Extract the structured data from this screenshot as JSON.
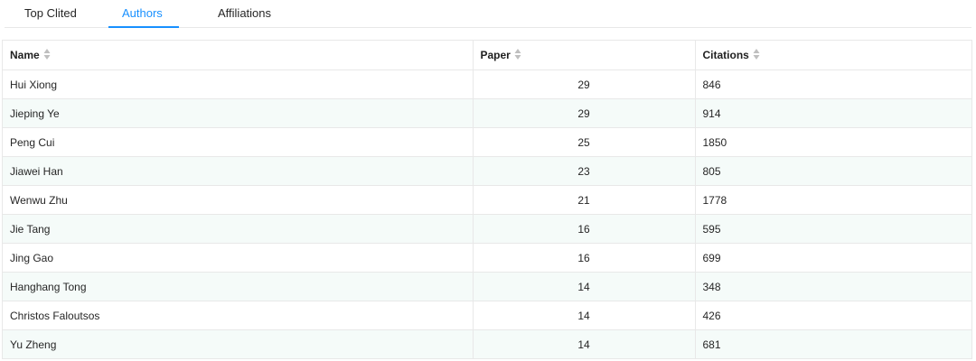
{
  "tabs": [
    {
      "label": "Top Clited",
      "active": false
    },
    {
      "label": "Authors",
      "active": true
    },
    {
      "label": "Affiliations",
      "active": false
    }
  ],
  "table": {
    "columns": [
      {
        "label": "Name",
        "sort_icon": "sort-icon"
      },
      {
        "label": "Paper",
        "sort_icon": "sort-icon"
      },
      {
        "label": "Citations",
        "sort_icon": "sort-icon"
      }
    ],
    "rows": [
      {
        "name": "Hui Xiong",
        "paper": "29",
        "citations": "846"
      },
      {
        "name": "Jieping Ye",
        "paper": "29",
        "citations": "914"
      },
      {
        "name": "Peng Cui",
        "paper": "25",
        "citations": "1850"
      },
      {
        "name": "Jiawei Han",
        "paper": "23",
        "citations": "805"
      },
      {
        "name": "Wenwu Zhu",
        "paper": "21",
        "citations": "1778"
      },
      {
        "name": "Jie Tang",
        "paper": "16",
        "citations": "595"
      },
      {
        "name": "Jing Gao",
        "paper": "16",
        "citations": "699"
      },
      {
        "name": "Hanghang Tong",
        "paper": "14",
        "citations": "348"
      },
      {
        "name": "Christos Faloutsos",
        "paper": "14",
        "citations": "426"
      },
      {
        "name": "Yu Zheng",
        "paper": "14",
        "citations": "681"
      }
    ]
  },
  "colors": {
    "accent": "#1890ff",
    "row_stripe": "#f5fbf9",
    "border": "#e8e8e8"
  }
}
